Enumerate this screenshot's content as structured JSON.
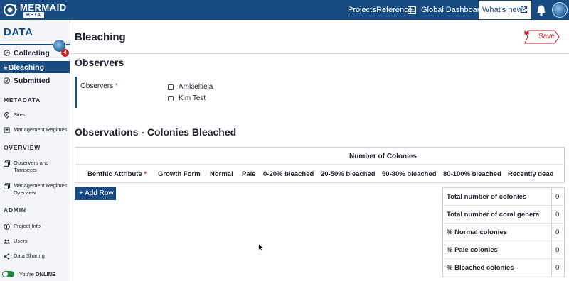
{
  "topbar": {
    "logo_text": "MERMAID",
    "logo_badge": "BETA",
    "nav": [
      "Projects",
      "Reference",
      "Global Dashboard"
    ],
    "whats_new": "What's new",
    "icons": [
      "mermaid-logo-icon",
      "table-icon",
      "external-link-icon",
      "bell-icon",
      "avatar"
    ]
  },
  "sidebar": {
    "title": "DATA",
    "badge_count": "4",
    "items": {
      "collecting": "Collecting",
      "bleaching": "Bleaching",
      "submitted": "Submitted"
    },
    "sections": {
      "metadata": "METADATA",
      "overview": "OVERVIEW",
      "admin": "ADMIN"
    },
    "metadata_items": [
      "Sites",
      "Management Regimes"
    ],
    "overview_items": [
      "Observers and Transects",
      "Management Regimes Overview"
    ],
    "admin_items": [
      "Project Info",
      "Users",
      "Data Sharing"
    ],
    "status_prefix": "You're ",
    "status_value": "ONLINE"
  },
  "page": {
    "title": "Bleaching",
    "save_label": "Save"
  },
  "observers": {
    "heading": "Observers",
    "label": "Observers",
    "required_mark": "*",
    "options": [
      "Amkieltiela",
      "Kim Test"
    ]
  },
  "colonies": {
    "heading": "Observations - Colonies Bleached",
    "group_header": "Number of Colonies",
    "columns": [
      "Benthic Attribute",
      "Growth Form",
      "Normal",
      "Pale",
      "0-20% bleached",
      "20-50% bleached",
      "50-80% bleached",
      "80-100% bleached",
      "Recently dead"
    ],
    "required_mark": "*",
    "add_row": "+ Add Row"
  },
  "summary": [
    {
      "label": "Total number of colonies",
      "value": "0"
    },
    {
      "label": "Total number of coral genera",
      "value": "0"
    },
    {
      "label": "% Normal colonies",
      "value": "0"
    },
    {
      "label": "% Pale colonies",
      "value": "0"
    },
    {
      "label": "% Bleached colonies",
      "value": "0"
    }
  ],
  "colors": {
    "primary": "#174b82",
    "danger": "#c4262e",
    "online": "#1f8a3a"
  }
}
